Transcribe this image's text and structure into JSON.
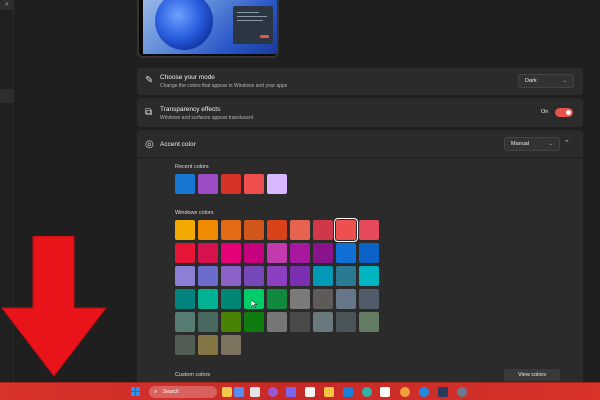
{
  "sidebar": {
    "search_icon": "search-icon"
  },
  "mode": {
    "title": "Choose your mode",
    "desc": "Change the colors that appear in Windows and your apps",
    "value": "Dark"
  },
  "transparency": {
    "title": "Transparency effects",
    "desc": "Windows and surfaces appear translucent",
    "state": "On"
  },
  "accent": {
    "title": "Accent color",
    "value": "Manual"
  },
  "recent": {
    "label": "Recent colors",
    "colors": [
      "#1677d2",
      "#9b4dc4",
      "#d63227",
      "#ef4f4f",
      "#d8b7ff"
    ]
  },
  "windows_colors": {
    "label": "Windows colors",
    "rows": [
      [
        "#f2a900",
        "#f08a00",
        "#e36b14",
        "#d0561a",
        "#d8431a",
        "#e66350",
        "#d0384a",
        "#ee5050",
        "#e6495b"
      ],
      [
        "#e81636",
        "#d4134f",
        "#e5007a",
        "#c6007f",
        "#c33aaf",
        "#a7189e",
        "#8a148c",
        "#1170d6",
        "#0b63c7"
      ],
      [
        "#8b80d6",
        "#6b6ccc",
        "#8a62c8",
        "#7547b8",
        "#8c3fc0",
        "#7a2fb0",
        "#009ab8",
        "#2b7a94",
        "#00b4c0"
      ],
      [
        "#03837d",
        "#00b294",
        "#018574",
        "#00cc6a",
        "#10893e",
        "#7b7a78",
        "#5d5a58",
        "#68768a",
        "#515c6b"
      ],
      [
        "#567c73",
        "#486860",
        "#498205",
        "#107c10",
        "#767676",
        "#4c4a48",
        "#69797e",
        "#4a5459",
        "#647c64"
      ],
      [
        "#525e54",
        "#847545",
        "#7e735f"
      ]
    ],
    "selected": [
      0,
      7
    ]
  },
  "custom": {
    "label": "Custom colors",
    "button": "View colors"
  },
  "taskbar": {
    "search_label": "Search"
  },
  "colors": {
    "accent": "#e5534b",
    "taskbar": "#d9332a",
    "arrow": "#e8141a"
  }
}
